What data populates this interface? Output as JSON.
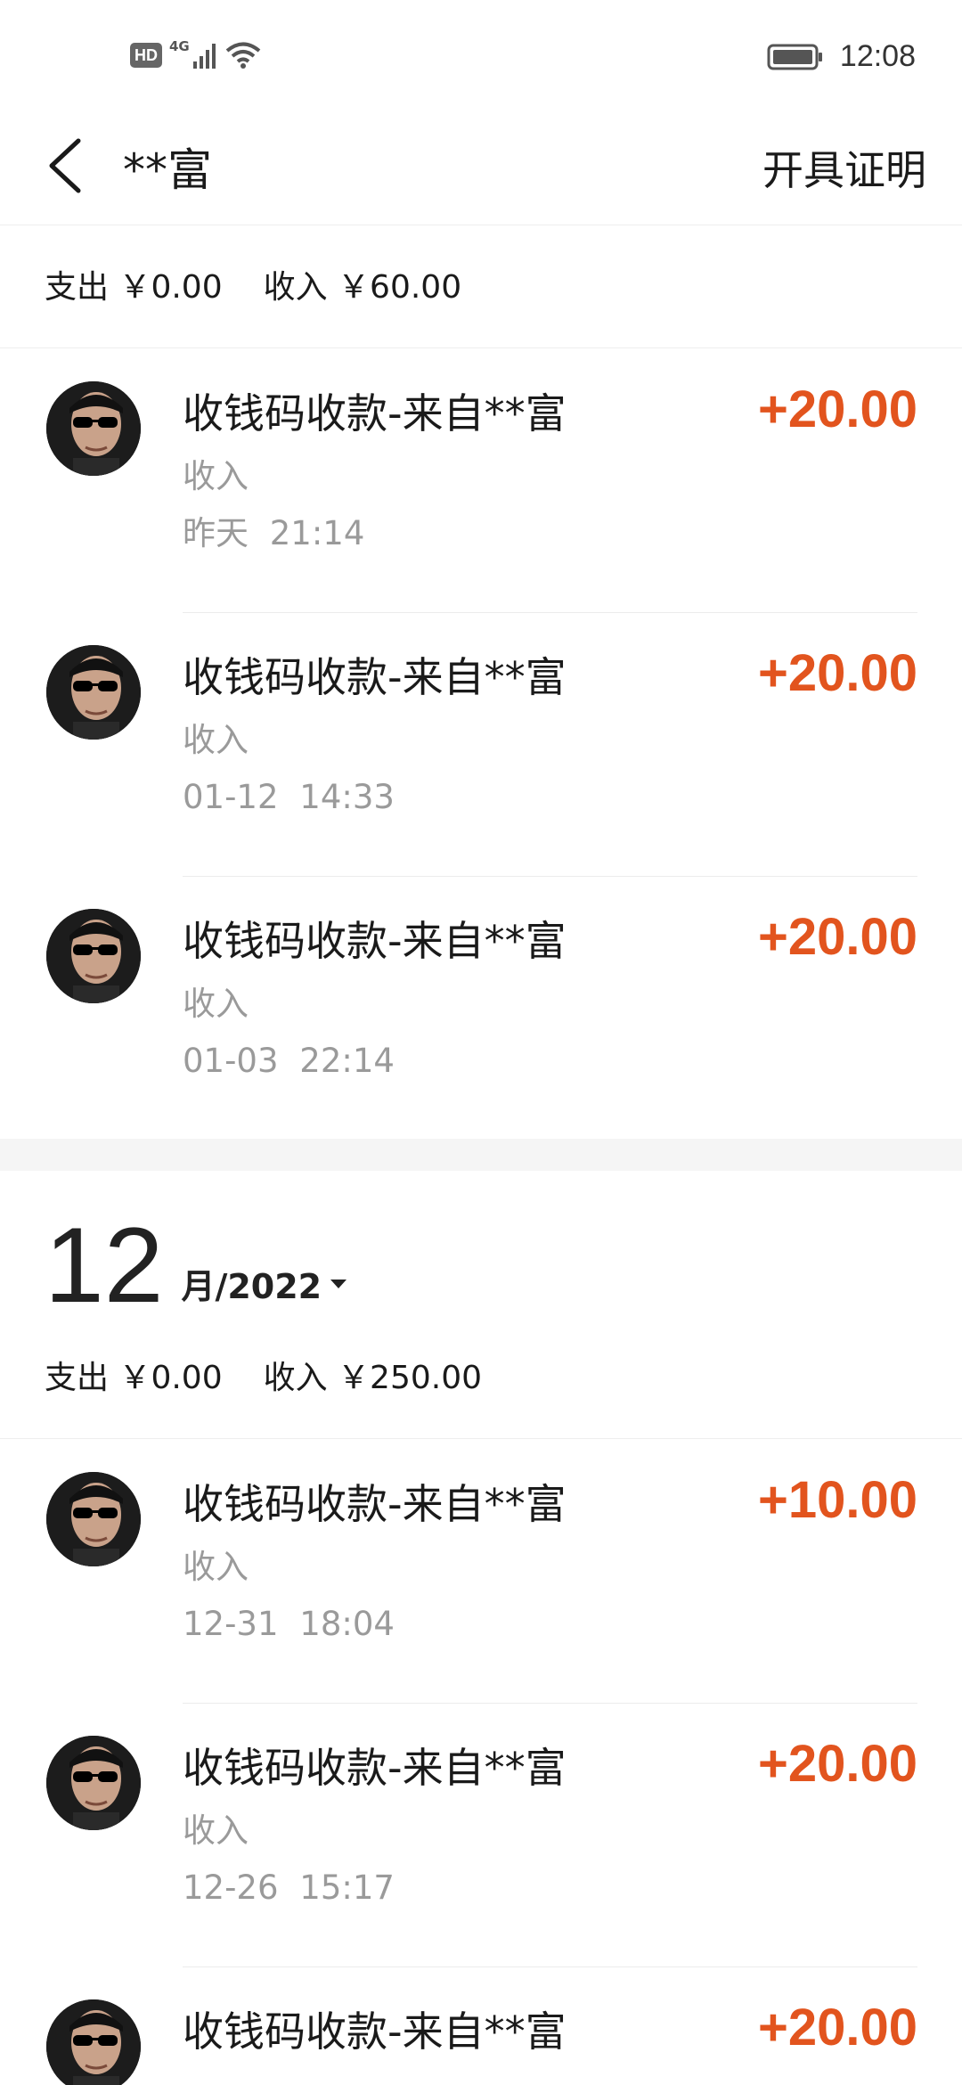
{
  "status_bar": {
    "hd": "HD",
    "network": "4G",
    "time": "12:08"
  },
  "header": {
    "title": "**富",
    "action": "开具证明"
  },
  "current_month_summary": {
    "expense": "支出 ￥0.00",
    "income": "收入 ￥60.00"
  },
  "current_month_items": [
    {
      "title": "收钱码收款-来自**富",
      "type": "收入",
      "time": "昨天 21:14",
      "amount": "+20.00"
    },
    {
      "title": "收钱码收款-来自**富",
      "type": "收入",
      "time": "01-12 14:33",
      "amount": "+20.00"
    },
    {
      "title": "收钱码收款-来自**富",
      "type": "收入",
      "time": "01-03 22:14",
      "amount": "+20.00"
    }
  ],
  "prev_month": {
    "month": "12",
    "year_label": "月/2022",
    "expense": "支出 ￥0.00",
    "income": "收入 ￥250.00"
  },
  "prev_month_items": [
    {
      "title": "收钱码收款-来自**富",
      "type": "收入",
      "time": "12-31 18:04",
      "amount": "+10.00"
    },
    {
      "title": "收钱码收款-来自**富",
      "type": "收入",
      "time": "12-26 15:17",
      "amount": "+20.00"
    },
    {
      "title": "收钱码收款-来自**富",
      "amount": "+20.00"
    }
  ],
  "colors": {
    "amount": "#e2541e",
    "secondary_text": "#9a9a9a"
  },
  "icons": {
    "back": "chevron-left-icon",
    "dropdown": "caret-down-icon",
    "battery": "battery-icon",
    "wifi": "wifi-icon",
    "signal": "signal-icon"
  }
}
